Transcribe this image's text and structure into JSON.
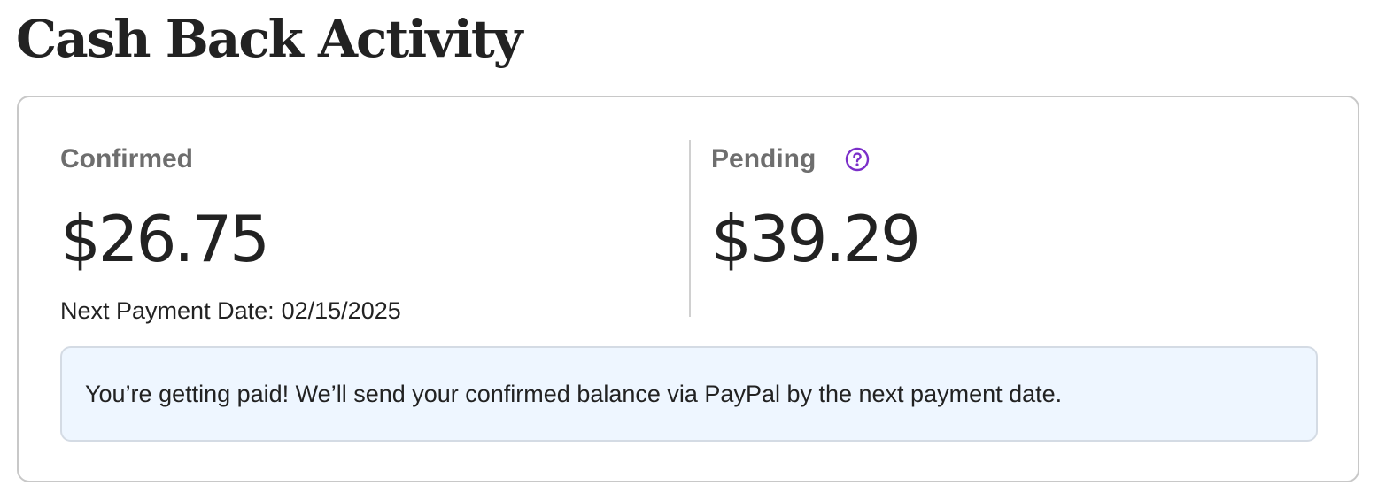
{
  "page": {
    "title": "Cash Back Activity"
  },
  "confirmed": {
    "label": "Confirmed",
    "amount": "$26.75",
    "next_payment_label": "Next Payment Date:",
    "next_payment_value": "02/15/2025"
  },
  "pending": {
    "label": "Pending",
    "amount": "$39.29",
    "help_icon": "question-circle-icon"
  },
  "banner": {
    "message": "You’re getting paid! We’ll send your confirmed balance via PayPal by the next payment date."
  },
  "colors": {
    "accent": "#7b2fc9",
    "banner_background": "#eef6ff",
    "label_gray": "#6e6e6e",
    "text": "#222222"
  }
}
